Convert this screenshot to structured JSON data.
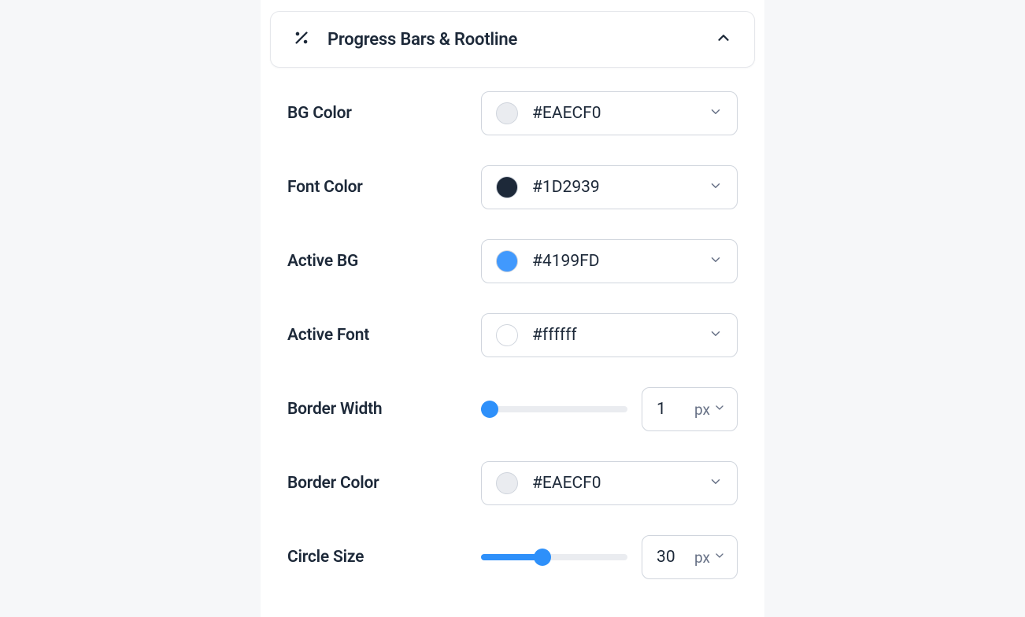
{
  "panel": {
    "title": "Progress Bars & Rootline"
  },
  "settings": {
    "bg_color": {
      "label": "BG Color",
      "value": "#EAECF0",
      "swatch": "#EAECF0"
    },
    "font_color": {
      "label": "Font Color",
      "value": "#1D2939",
      "swatch": "#1D2939"
    },
    "active_bg": {
      "label": "Active BG",
      "value": "#4199FD",
      "swatch": "#4199FD"
    },
    "active_font": {
      "label": "Active Font",
      "value": "#ffffff",
      "swatch": "#ffffff"
    },
    "border_width": {
      "label": "Border Width",
      "value": "1",
      "unit": "px",
      "slider_percent": 6
    },
    "border_color": {
      "label": "Border Color",
      "value": "#EAECF0",
      "swatch": "#EAECF0"
    },
    "circle_size": {
      "label": "Circle Size",
      "value": "30",
      "unit": "px",
      "slider_percent": 42
    }
  }
}
